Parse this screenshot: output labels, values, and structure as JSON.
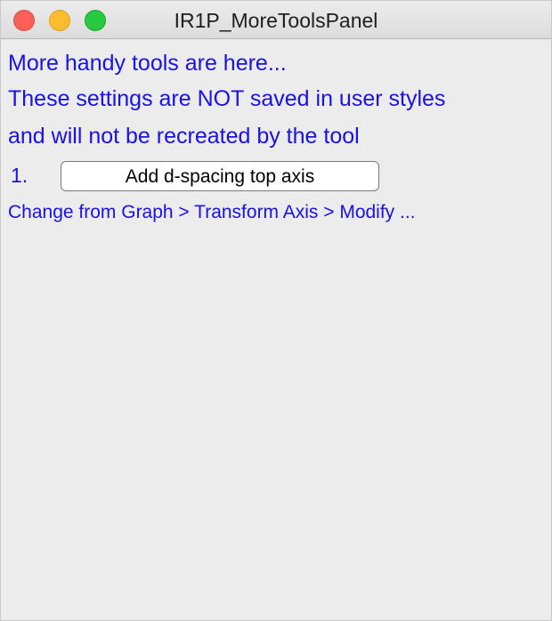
{
  "window": {
    "title": "IR1P_MoreToolsPanel"
  },
  "panel": {
    "intro": "More handy tools are here...",
    "warning_line1": "These settings are NOT saved in user styles",
    "warning_line2": "and will not be recreated by the tool",
    "item_number": "1.",
    "add_dspacing_button": "Add d-spacing top axis",
    "hint": "Change from Graph > Transform Axis > Modify ..."
  },
  "colors": {
    "text_accent": "#1a10e8",
    "background": "#ececec",
    "close": "#fc5f57",
    "minimize": "#fdbc2e",
    "zoom": "#28c840"
  }
}
